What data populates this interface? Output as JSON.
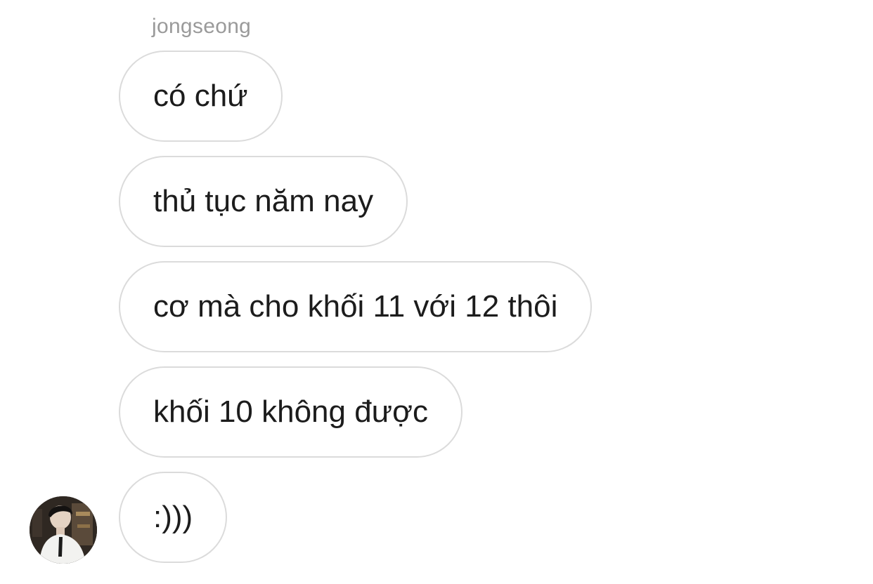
{
  "sender": {
    "name": "jongseong"
  },
  "messages": [
    {
      "text": "có chứ"
    },
    {
      "text": "thủ tục năm nay"
    },
    {
      "text": "cơ mà cho khối 11 với 12 thôi"
    },
    {
      "text": "khối 10 không được"
    },
    {
      "text": ":)))"
    }
  ],
  "avatar": {
    "icon": "profile-photo-person-in-white-shirt"
  },
  "colors": {
    "background": "#ffffff",
    "bubble_border": "#dbdbdb",
    "message_text": "#1c1c1c",
    "sender_text": "#9a9a9a"
  }
}
